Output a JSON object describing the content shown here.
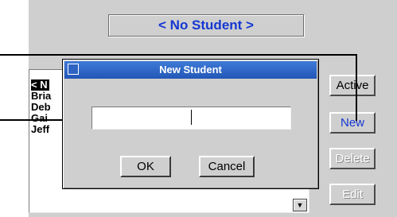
{
  "header": {
    "student_display": "< No Student >"
  },
  "student_list": {
    "items": [
      {
        "label": "< N",
        "selected": true
      },
      {
        "label": "Bria",
        "selected": false
      },
      {
        "label": "Deb",
        "selected": false
      },
      {
        "label": "Gai",
        "selected": false
      },
      {
        "label": "Jeff",
        "selected": false
      }
    ],
    "scroll_arrow": "▼"
  },
  "side_buttons": {
    "active": "Active",
    "new": "New",
    "delete": "Delete",
    "edit": "Edit"
  },
  "dialog": {
    "title": "New Student",
    "title_icon": "window-icon",
    "name_value": "",
    "ok_label": "OK",
    "cancel_label": "Cancel"
  },
  "colors": {
    "accent_text": "#1437d2",
    "titlebar": "#2e63c2",
    "panel": "#cfcfcf"
  }
}
